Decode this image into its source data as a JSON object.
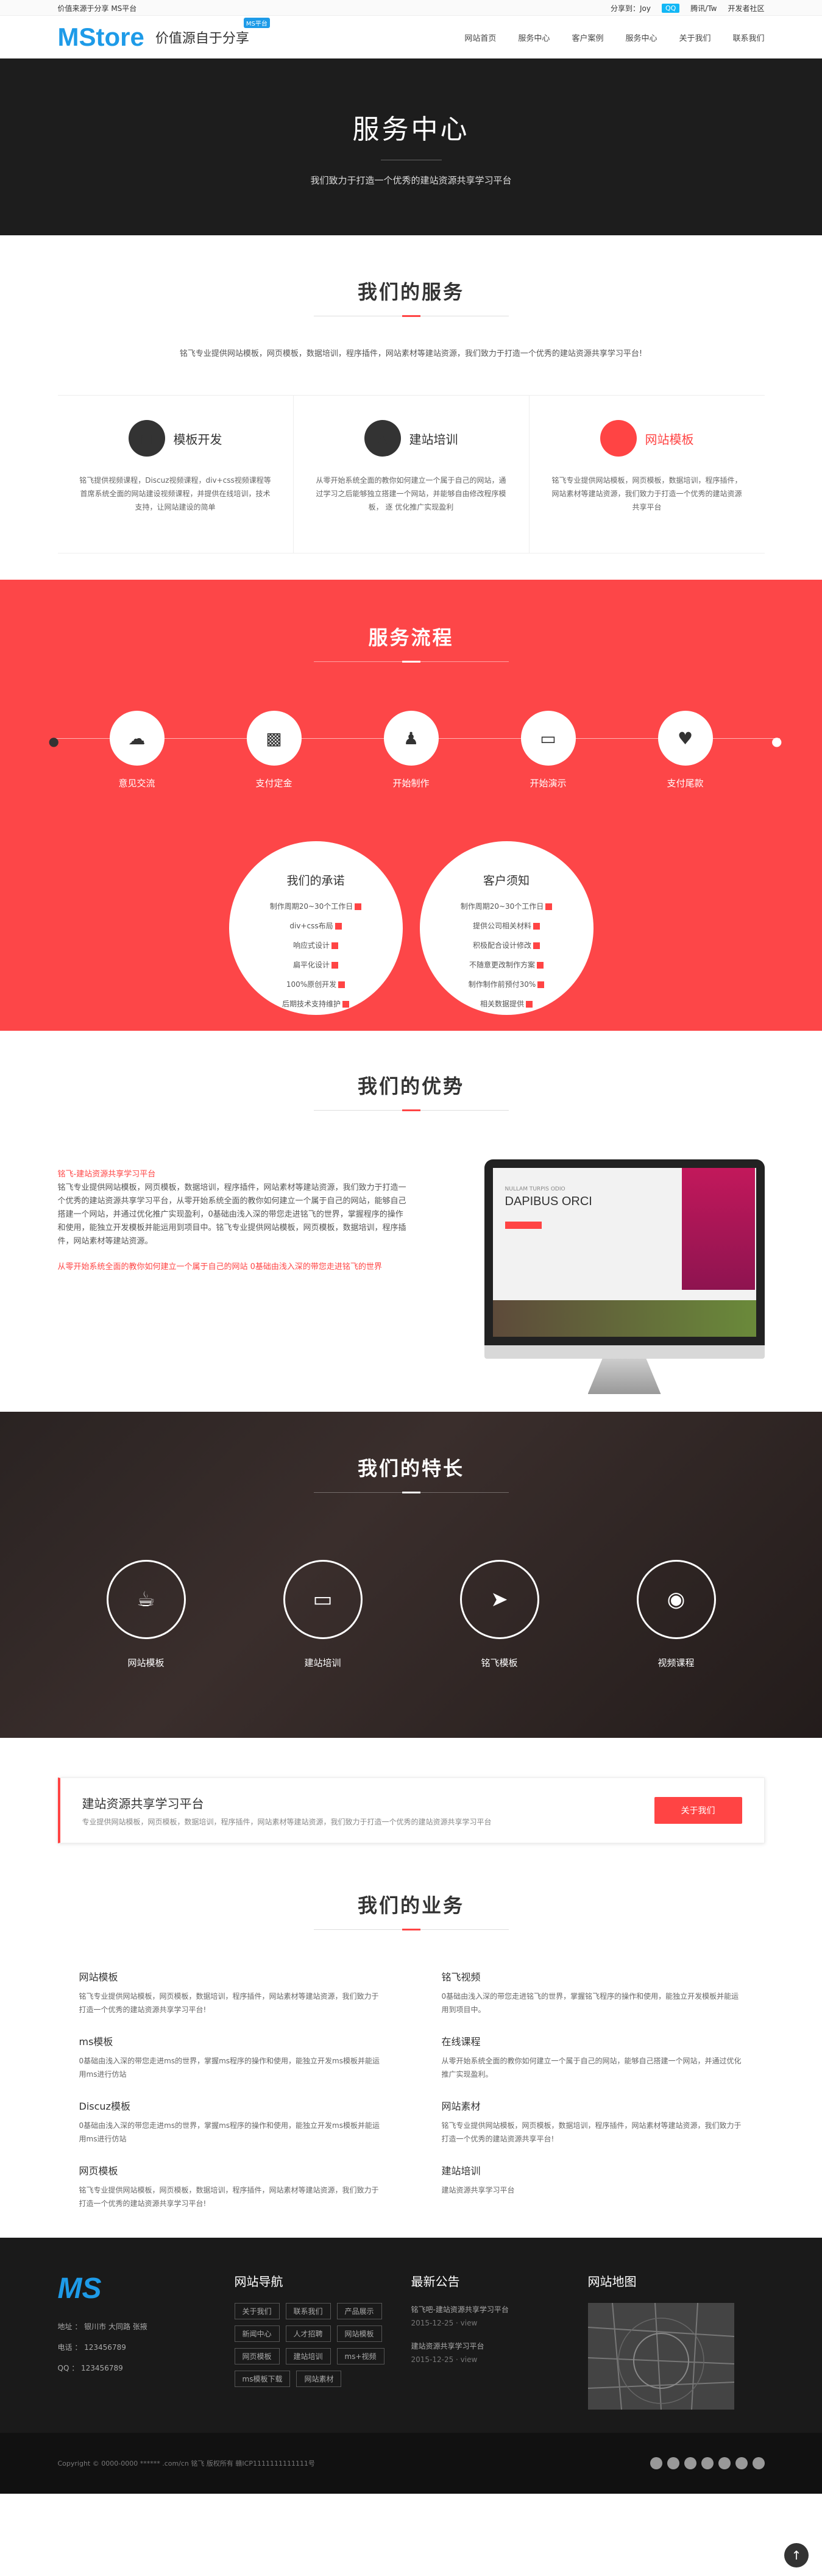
{
  "topbar": {
    "left": "价值来源于分享 MS平台",
    "share": "分享到：Joy",
    "qq": "QQ",
    "weibo": "腾讯/Tw",
    "dev": "开发者社区"
  },
  "header": {
    "logo": "MStore",
    "slogan": "价值源自于分享",
    "badge": "MS平台"
  },
  "nav": [
    "网站首页",
    "服务中心",
    "客户案例",
    "服务中心",
    "关于我们",
    "联系我们"
  ],
  "hero": {
    "title": "服务中心",
    "subtitle": "我们致力于打造一个优秀的建站资源共享学习平台"
  },
  "services": {
    "title": "我们的服务",
    "intro": "铭飞专业提供网站模板，网页模板，数据培训，程序插件，网站素材等建站资源，我们致力于打造一个优秀的建站资源共享学习平台!",
    "items": [
      {
        "name": "模板开发",
        "icon": "book-icon",
        "desc": "铭飞提供视频课程，Discuz视频课程，div+css视频课程等首席系统全面的网站建设视频课程，并提供在线培训，技术支持，让网站建设的简单"
      },
      {
        "name": "建站培训",
        "icon": "bell-icon",
        "desc": "从零开始系统全面的教你如何建立一个属于自己的网站，通过学习之后能够独立搭建一个网站，并能够自由修改程序模板， 逐 优化推广实现盈利"
      },
      {
        "name": "网站模板",
        "icon": "display-icon",
        "desc": "铭飞专业提供网站模板，网页模板，数据培训，程序插件，网站素材等建站资源，我们致力于打造一个优秀的建站资源共享平台"
      }
    ]
  },
  "process": {
    "title": "服务流程",
    "steps": [
      "意见交流",
      "支付定金",
      "开始制作",
      "开始演示",
      "支付尾款"
    ],
    "promise": {
      "title": "我们的承诺",
      "items": [
        "制作周期20~30个工作日",
        "div+css布局",
        "响应式设计",
        "扁平化设计",
        "100%原创开发",
        "后期技术支持维护"
      ]
    },
    "notice": {
      "title": "客户须知",
      "items": [
        "制作周期20~30个工作日",
        "提供公司相关材料",
        "积极配合设计修改",
        "不随意更改制作方案",
        "制作制作前预付30%",
        "相关数据提供"
      ]
    }
  },
  "advantage": {
    "title": "我们的优势",
    "lead": "铭飞-建站资源共享学习平台",
    "body": "铭飞专业提供网站模板，网页模板，数据培训，程序插件，网站素材等建站资源，我们致力于打造一个优秀的建站资源共享学习平台，从零开始系统全面的教你如何建立一个属于自己的网站，能够自己搭建一个网站，并通过优化推广实现盈利，0基础由浅入深的带您走进铭飞的世界，掌握程序的操作和使用，能独立开发模板并能运用到项目中。铭飞专业提供网站模板，网页模板，数据培训，程序插件，网站素材等建站资源。",
    "tail": "从零开始系统全面的教你如何建立一个属于自己的网站 0基础由浅入深的带您走进铭飞的世界",
    "screen": {
      "small": "NULLAM TURPIS ODIO",
      "big": "DAPIBUS ORCI"
    }
  },
  "features": {
    "title": "我们的特长",
    "items": [
      {
        "label": "网站模板",
        "icon": "cup-icon"
      },
      {
        "label": "建站培训",
        "icon": "monitor-icon"
      },
      {
        "label": "铭飞模板",
        "icon": "cursor-icon"
      },
      {
        "label": "视频课程",
        "icon": "camera-icon"
      }
    ]
  },
  "banner": {
    "title": "建站资源共享学习平台",
    "desc": "专业提供网站模板，网页模板，数据培训，程序插件，网站素材等建站资源，我们致力于打造一个优秀的建站资源共享学习平台",
    "button": "关于我们"
  },
  "business": {
    "title": "我们的业务",
    "items": [
      {
        "name": "网站模板",
        "desc": "铭飞专业提供网站模板，网页模板，数据培训，程序插件，网站素材等建站资源，我们致力于打造一个优秀的建站资源共享学习平台!"
      },
      {
        "name": "铭飞视频",
        "desc": "0基础由浅入深的带您走进铭飞的世界，掌握铭飞程序的操作和使用，能独立开发模板并能运用到项目中。"
      },
      {
        "name": "ms模板",
        "desc": "0基础由浅入深的带您走进ms的世界，掌握ms程序的操作和使用，能独立开发ms模板并能运用ms进行仿站"
      },
      {
        "name": "在线课程",
        "desc": "从零开始系统全面的教你如何建立一个属于自己的网站，能够自己搭建一个网站，并通过优化推广实现盈利。"
      },
      {
        "name": "Discuz模板",
        "desc": "0基础由浅入深的带您走进ms的世界，掌握ms程序的操作和使用，能独立开发ms模板并能运用ms进行仿站"
      },
      {
        "name": "网站素材",
        "desc": "铭飞专业提供网站模板，网页模板，数据培训，程序插件，网站素材等建站资源，我们致力于打造一个优秀的建站资源共享平台!"
      },
      {
        "name": "网页模板",
        "desc": "铭飞专业提供网站模板，网页模板，数据培训，程序插件，网站素材等建站资源，我们致力于打造一个优秀的建站资源共享学习平台!"
      },
      {
        "name": "建站培训",
        "desc": "建站资源共享学习平台"
      }
    ]
  },
  "footer": {
    "logo": "MS",
    "info": [
      "地址 ： 银川市 大同路 张掖",
      "电话 ： 123456789",
      "QQ ： 123456789"
    ],
    "nav_title": "网站导航",
    "tags": [
      "关于我们",
      "联系我们",
      "产品展示",
      "新闻中心",
      "人才招聘",
      "网站模板",
      "网页模板",
      "建站培训",
      "ms+视频",
      "ms模板下载",
      "网站素材"
    ],
    "news_title": "最新公告",
    "news": [
      {
        "title": "铭飞吧-建站资源共享学习平台",
        "date": "2015-12-25 · view"
      },
      {
        "title": "建站资源共享学习平台",
        "date": "2015-12-25 · view"
      }
    ],
    "map_title": "网站地图",
    "copyright": "Copyright © 0000-0000 ****** .com/cn 铭飞 版权所有 赣ICP1111111111111号"
  },
  "colors": {
    "accent": "#fd4648",
    "brand": "#1e9be8",
    "dark": "#1d1d1d"
  }
}
